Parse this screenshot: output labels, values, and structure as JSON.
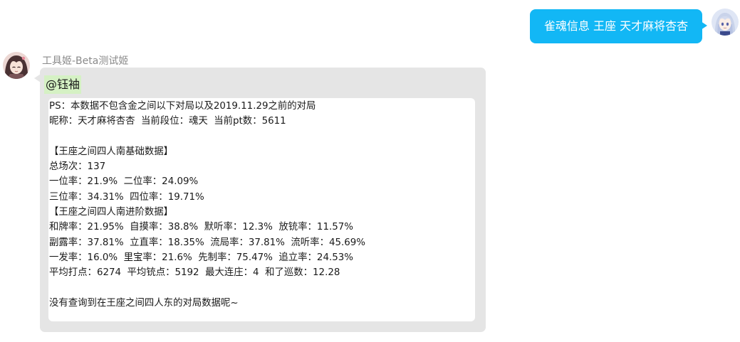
{
  "chat": {
    "outgoing": {
      "text": "雀魂信息 王座 天才麻将杏杏",
      "bubble_color": "#12b7f5",
      "avatar_icon": "anime-girl-avatar-icon"
    },
    "incoming": {
      "sender_name": "工具姬-Beta测试姬",
      "avatar_icon": "anime-girl-avatar-icon",
      "bubble_color": "#e5e5e5",
      "mention": "@钰袖",
      "mention_color": "#d5f1c4",
      "lines": [
        "PS：本数据不包含金之间以下对局以及2019.11.29之前的对局",
        "昵称：天才麻将杏杏  当前段位：魂天  当前pt数：5611",
        "",
        "【王座之间四人南基础数据】",
        "总场次：137",
        "一位率：21.9%  二位率：24.09%",
        "三位率：34.31%  四位率：19.71%",
        "【王座之间四人南进阶数据】",
        "和牌率：21.95%  自摸率：38.8%  默听率：12.3%  放铳率：11.57%",
        "副露率：37.81%  立直率：18.35%  流局率：37.81%  流听率：45.69%",
        "一发率：16.0%  里宝率：21.6%  先制率：75.47%  追立率：24.53%",
        "平均打点：6274  平均铳点：5192  最大连庄：4  和了巡数：12.28",
        "",
        "没有查询到在王座之间四人东的对局数据呢~"
      ]
    }
  }
}
